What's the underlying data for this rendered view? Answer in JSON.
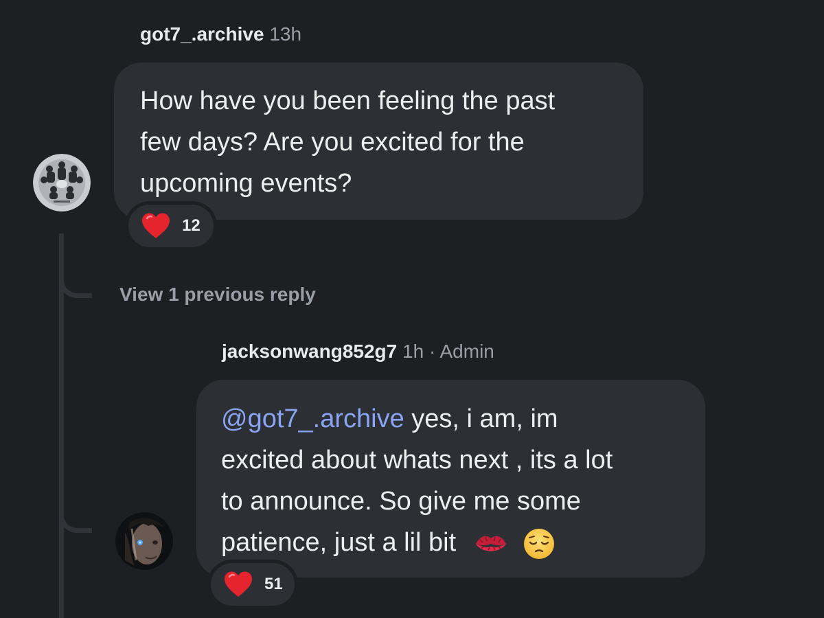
{
  "colors": {
    "background": "#1e1f22",
    "bubble": "#2c2f34",
    "mention": "#8aa4f4",
    "muted": "#9a9ea6",
    "heart": "#e5242e"
  },
  "comment1": {
    "author": "got7_.archive",
    "time": "13h",
    "lines": [
      "How have you been feeling the past",
      "few days? Are you excited for the",
      "upcoming events?"
    ],
    "reaction": {
      "icon": "heart-icon",
      "count": "12"
    }
  },
  "view_replies": "View 1 previous reply",
  "reply1": {
    "author": "jacksonwang852g7",
    "meta": "1h · Admin",
    "mention": "@got7_.archive",
    "line1_rest": " yes, i am, im",
    "line2": "excited about whats next , its a lot",
    "line3": "to announce. So give me some",
    "line4": "patience, just a lil bit",
    "emojis": [
      "kiss-mark-icon",
      "pensive-face-icon"
    ],
    "reaction": {
      "icon": "heart-icon",
      "count": "51"
    }
  }
}
